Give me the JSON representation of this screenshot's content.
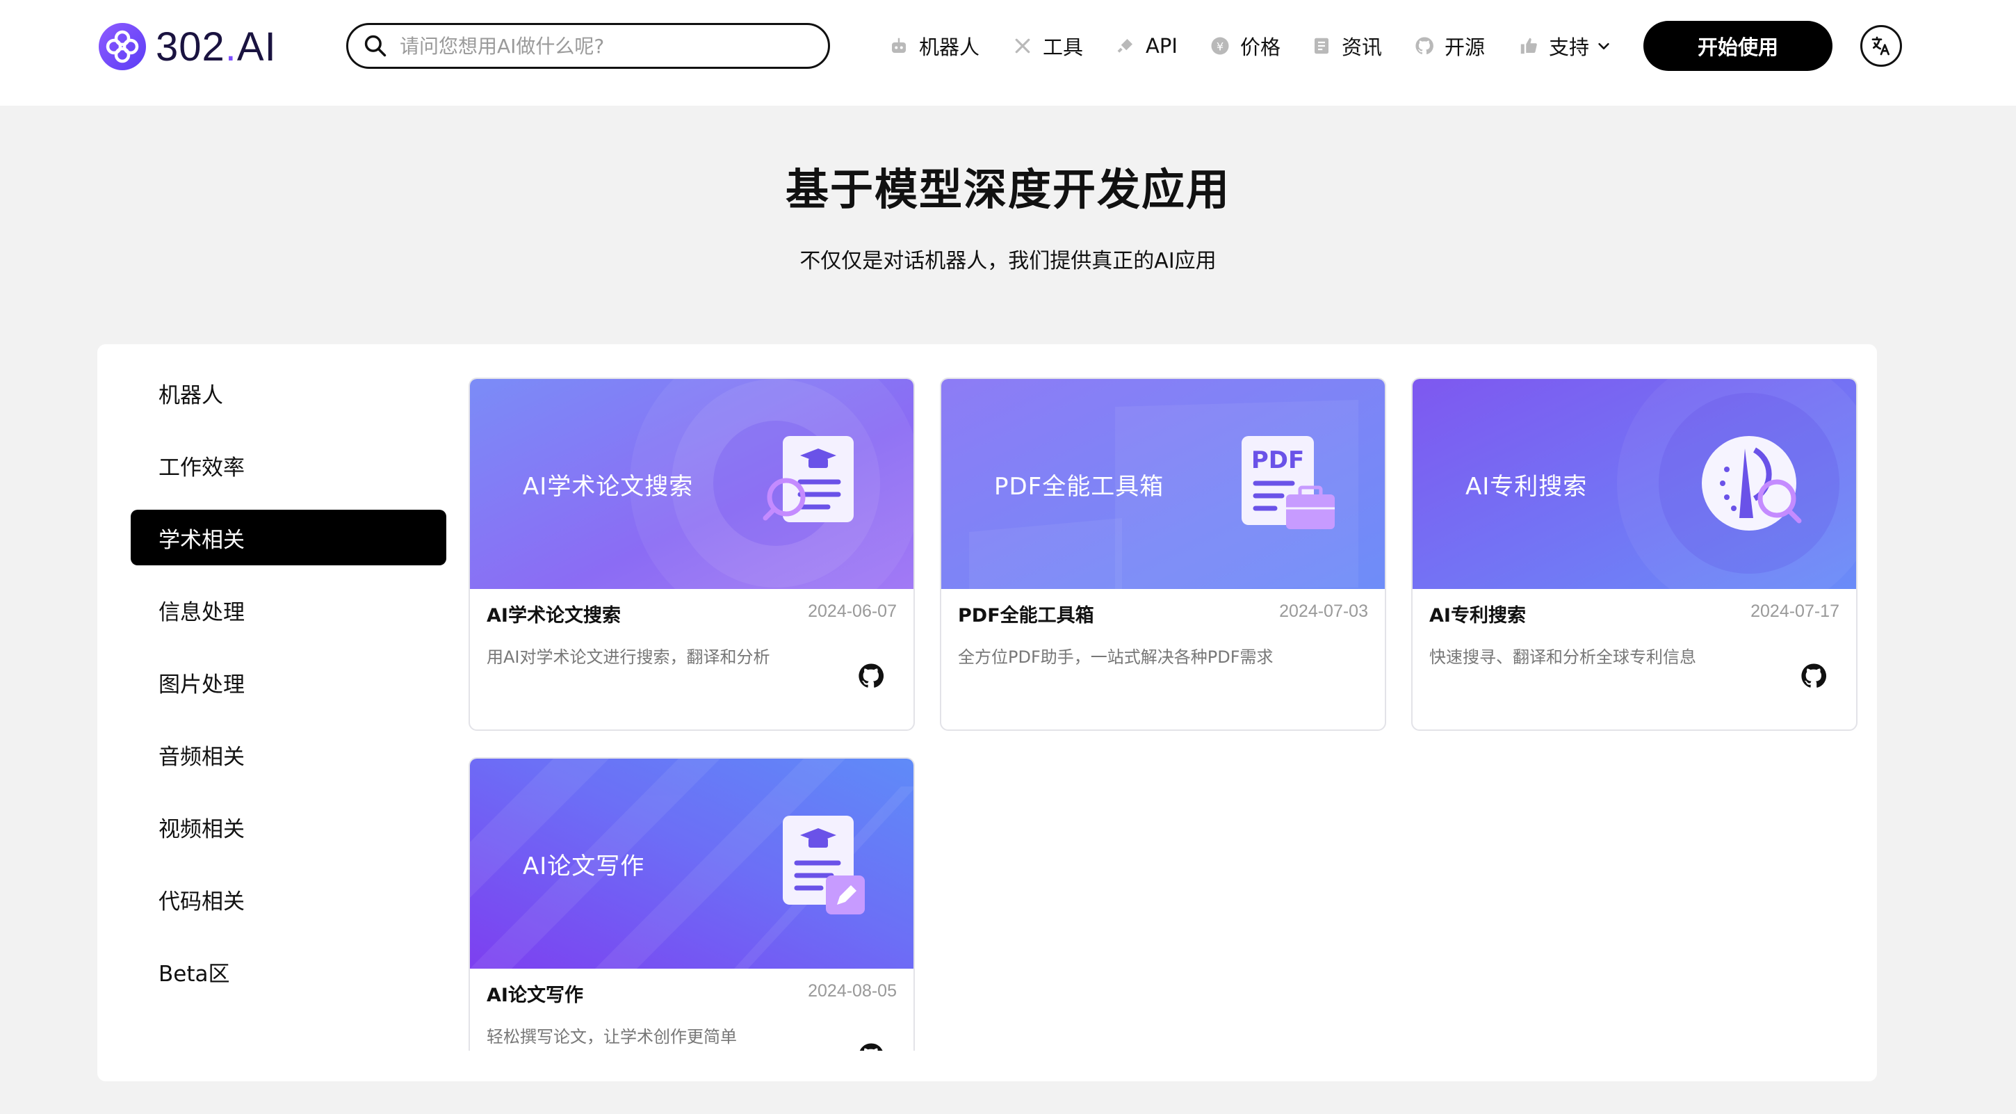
{
  "header": {
    "logo": {
      "text_main": "302",
      "text_dot": ".",
      "text_suffix": "AI"
    },
    "search": {
      "placeholder": "请问您想用AI做什么呢?"
    },
    "nav": [
      {
        "label": "机器人",
        "icon": "robot-icon"
      },
      {
        "label": "工具",
        "icon": "tools-icon"
      },
      {
        "label": "API",
        "icon": "plug-icon"
      },
      {
        "label": "价格",
        "icon": "coin-icon"
      },
      {
        "label": "资讯",
        "icon": "document-icon"
      },
      {
        "label": "开源",
        "icon": "github-icon"
      },
      {
        "label": "支持",
        "icon": "thumbs-up-icon"
      }
    ],
    "cta_label": "开始使用",
    "language_icon": "translate-icon"
  },
  "hero": {
    "title": "基于模型深度开发应用",
    "subtitle": "不仅仅是对话机器人，我们提供真正的AI应用"
  },
  "sidebar": {
    "items": [
      {
        "label": "机器人"
      },
      {
        "label": "工作效率"
      },
      {
        "label": "学术相关",
        "active": true
      },
      {
        "label": "信息处理"
      },
      {
        "label": "图片处理"
      },
      {
        "label": "音频相关"
      },
      {
        "label": "视频相关"
      },
      {
        "label": "代码相关"
      },
      {
        "label": "Beta区"
      }
    ]
  },
  "cards": [
    {
      "banner_title": "AI学术论文搜索",
      "name": "AI学术论文搜索",
      "date": "2024-06-07",
      "description": "用AI对学术论文进行搜索，翻译和分析",
      "has_github": true
    },
    {
      "banner_title": "PDF全能工具箱",
      "name": "PDF全能工具箱",
      "date": "2024-07-03",
      "description": "全方位PDF助手，一站式解决各种PDF需求",
      "has_github": false,
      "banner_icon_text": "PDF"
    },
    {
      "banner_title": "AI专利搜索",
      "name": "AI专利搜索",
      "date": "2024-07-17",
      "description": "快速搜寻、翻译和分析全球专利信息",
      "has_github": true
    },
    {
      "banner_title": "AI论文写作",
      "name": "AI论文写作",
      "date": "2024-08-05",
      "description": "轻松撰写论文，让学术创作更简单",
      "has_github": true
    }
  ],
  "colors": {
    "accent": "#7c4dff",
    "brand_dark": "#1a1340",
    "active_bg": "#000000"
  }
}
